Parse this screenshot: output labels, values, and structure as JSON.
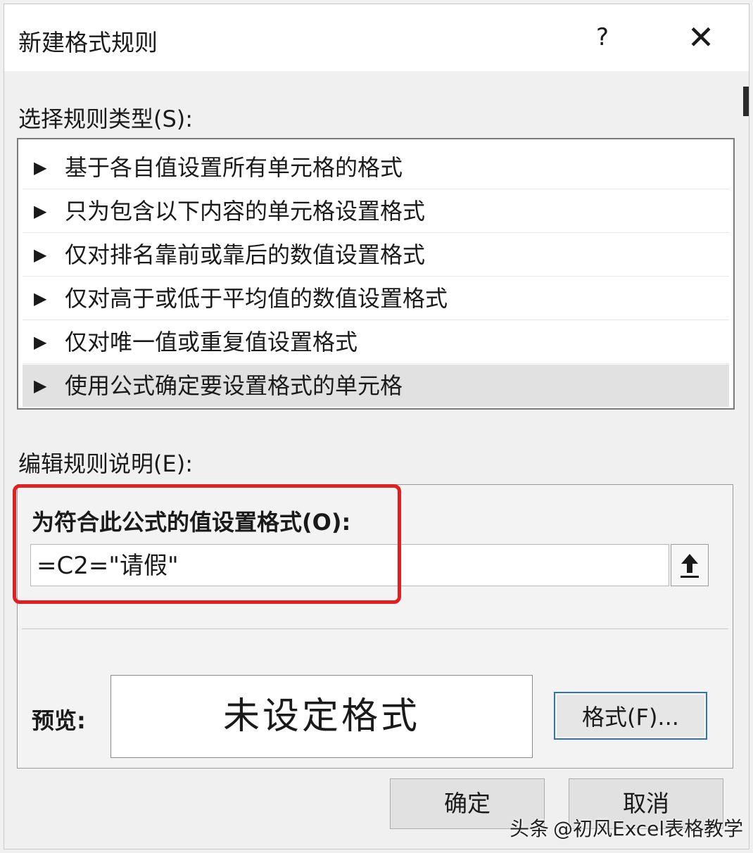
{
  "dialog": {
    "title": "新建格式规则",
    "help_label": "?",
    "close_label": "✕"
  },
  "rule_type": {
    "label": "选择规则类型(S):",
    "arrow": "▶",
    "items": [
      "基于各自值设置所有单元格的格式",
      "只为包含以下内容的单元格设置格式",
      "仅对排名靠前或靠后的数值设置格式",
      "仅对高于或低于平均值的数值设置格式",
      "仅对唯一值或重复值设置格式",
      "使用公式确定要设置格式的单元格"
    ],
    "selected_index": 5
  },
  "edit_rule": {
    "label": "编辑规则说明(E):",
    "formula_label": "为符合此公式的值设置格式(O):",
    "formula_value": "=C2=\"请假\"",
    "preview_label": "预览:",
    "preview_text": "未设定格式",
    "format_button": "格式(F)..."
  },
  "buttons": {
    "ok": "确定",
    "cancel": "取消"
  },
  "watermark": {
    "prefix": "头条",
    "text": "@初风Excel表格教学"
  },
  "colors": {
    "highlight": "#e02020",
    "focus_border": "#2b6fd6"
  }
}
